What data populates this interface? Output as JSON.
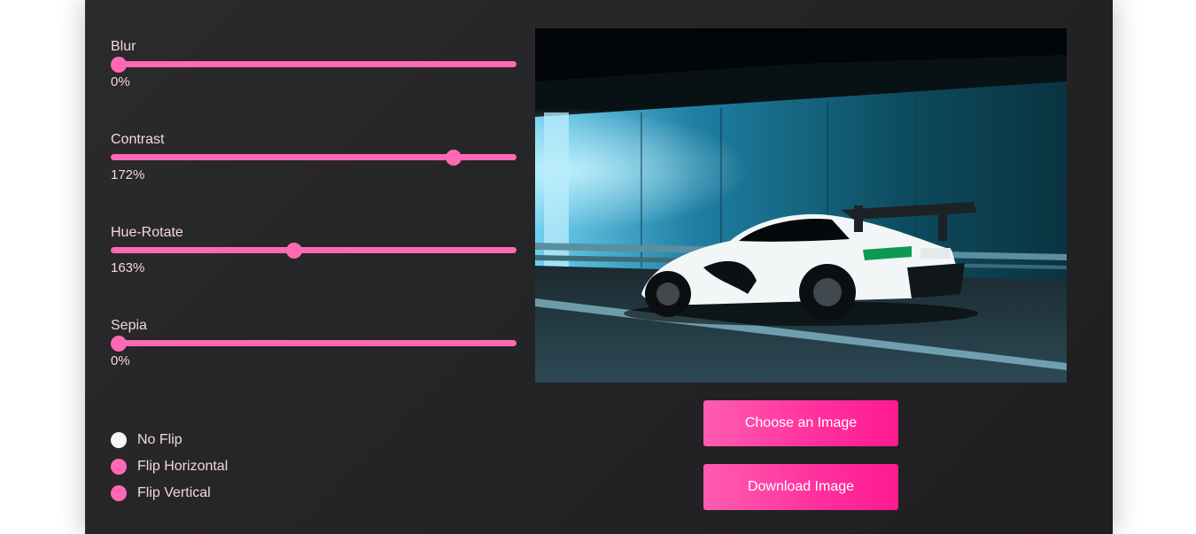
{
  "sliders": [
    {
      "label": "Blur",
      "value_text": "0%",
      "level": 0.0
    },
    {
      "label": "Contrast",
      "value_text": "172%",
      "level": 0.86
    },
    {
      "label": "Hue-Rotate",
      "value_text": "163%",
      "level": 0.45
    },
    {
      "label": "Sepia",
      "value_text": "0%",
      "level": 0.0
    }
  ],
  "flip": {
    "options": [
      {
        "label": "No Flip",
        "checked": true
      },
      {
        "label": "Flip Horizontal",
        "checked": false
      },
      {
        "label": "Flip Vertical",
        "checked": false
      }
    ]
  },
  "buttons": {
    "choose": "Choose an Image",
    "download": "Download Image"
  },
  "colors": {
    "accent": "#ff69b4",
    "panel_bg": "#252426",
    "text": "#f3d6e5"
  }
}
